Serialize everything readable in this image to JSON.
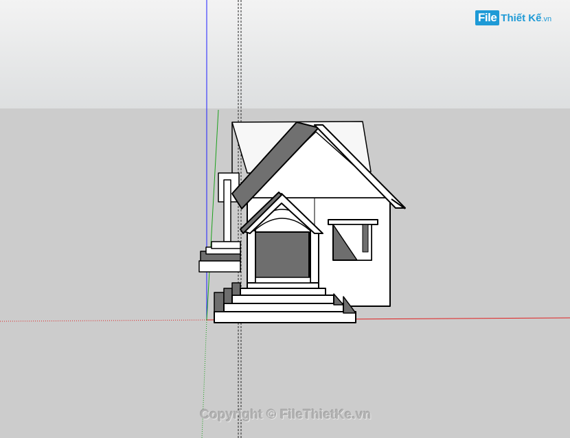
{
  "logo": {
    "box": "File",
    "brand": "Thiết Kế",
    "tld": ".vn"
  },
  "watermark": "Copyright © FileThietKe.vn",
  "colors": {
    "sky_top": "#f2f2f2",
    "sky_bottom": "#dcdedf",
    "ground": "#cccccc",
    "axis_blue": "#0000ff",
    "axis_red": "#ff0000",
    "axis_green": "#00aa00",
    "roof_dark": "#6e6e6e",
    "wall": "#ffffff",
    "brand": "#1e9ad6"
  }
}
